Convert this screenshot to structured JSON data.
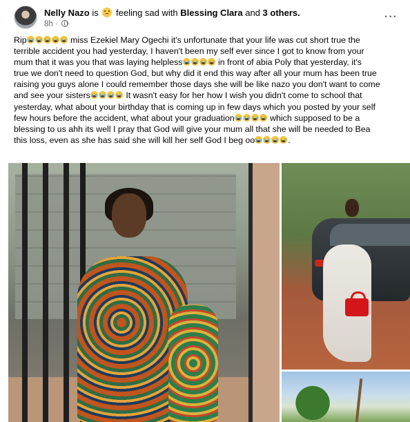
{
  "post": {
    "author": "Nelly Nazo",
    "is_text": "is",
    "feeling_text": "feeling sad with",
    "tagged": "Blessing Clara",
    "and_text": "and",
    "others": "3 others.",
    "time": "8h",
    "privacy_icon": "globe-icon",
    "feeling_icon": "sad-face-icon",
    "more_icon": "more-options-icon",
    "more_label": "···"
  },
  "body": {
    "lines": [
      {
        "pre": "Rip",
        "emojis": 5,
        "post": " miss Ezekiel Mary Ogechi it's unfortunate that your life was cut short true the"
      },
      {
        "pre": "terrible accident you had yesterday, I haven't been my self ever since I got to know from your",
        "emojis": 0,
        "post": ""
      },
      {
        "pre": "mum that it was you that was laying helpless",
        "emojis": 4,
        "post": " in front of abia Poly that yesterday, it's"
      },
      {
        "pre": "true we don't need to question God, but why did it end this way after all your mum has been true",
        "emojis": 0,
        "post": ""
      },
      {
        "pre": "raising you guys alone I could remember those days she will be like nazo you don't want to come",
        "emojis": 0,
        "post": ""
      },
      {
        "pre": "and see your sisters",
        "emojis": 4,
        "post": " It wasn't easy for her how I wish you didn't come to school that"
      },
      {
        "pre": "yesterday, what about your birthday that is coming up in few days which you posted by your self",
        "emojis": 0,
        "post": ""
      },
      {
        "pre": "few hours before the accident, what about your graduation",
        "emojis": 4,
        "post": " which supposed to be a"
      },
      {
        "pre": "blessing to us ahh its well I pray that God will give your mum all that she will be needed to Bea",
        "emojis": 0,
        "post": ""
      },
      {
        "pre": "this loss, even as she has said she will kill her self God I beg oo",
        "emojis": 4,
        "post": "."
      }
    ],
    "emoji_icon": "crying-face-icon"
  },
  "photos": {
    "main": "photo-woman-at-gate",
    "top_right": "photo-woman-by-car",
    "bottom_right": "photo-trees-sky"
  },
  "colors": {
    "text": "#050505",
    "meta": "#65676b"
  }
}
